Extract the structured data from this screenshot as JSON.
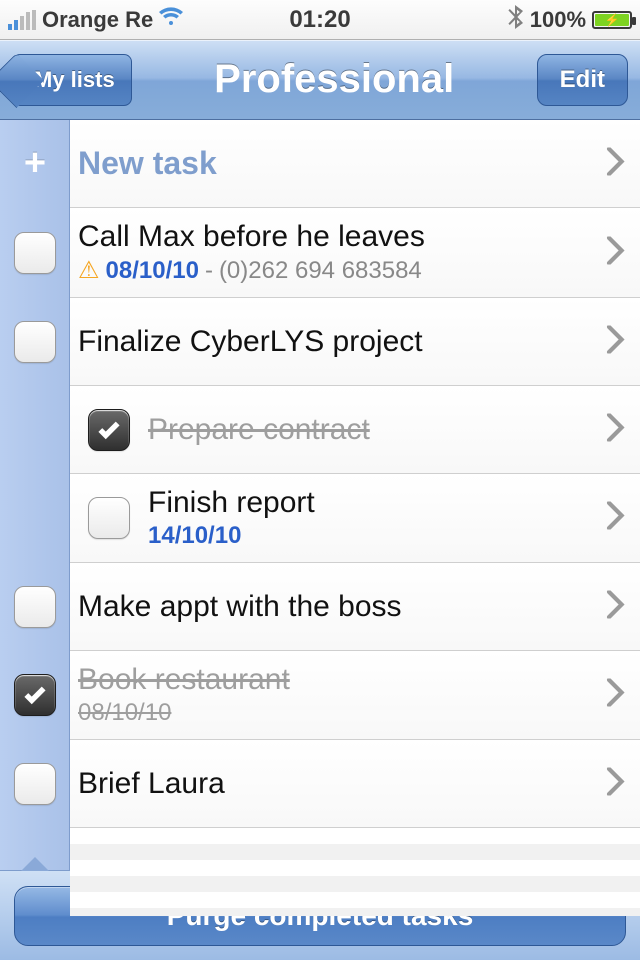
{
  "status": {
    "carrier": "Orange Re",
    "time": "01:20",
    "battery_pct": "100%"
  },
  "nav": {
    "back_label": "My lists",
    "title": "Professional",
    "edit_label": "Edit"
  },
  "new_task_label": "New task",
  "tasks": [
    {
      "title": "Call Max before he leaves",
      "date": "08/10/10",
      "extra": "(0)262 694 683584",
      "warning": true,
      "completed": false,
      "indent": false
    },
    {
      "title": "Finalize CyberLYS project",
      "completed": false,
      "indent": false
    },
    {
      "title": "Prepare contract",
      "completed": true,
      "indent": true
    },
    {
      "title": "Finish report",
      "date": "14/10/10",
      "completed": false,
      "indent": true
    },
    {
      "title": "Make appt with the boss",
      "completed": false,
      "indent": false
    },
    {
      "title": "Book restaurant",
      "date": "08/10/10",
      "completed": true,
      "indent": false
    },
    {
      "title": "Brief Laura",
      "completed": false,
      "indent": false
    }
  ],
  "bottom": {
    "purge_label": "Purge completed tasks"
  }
}
